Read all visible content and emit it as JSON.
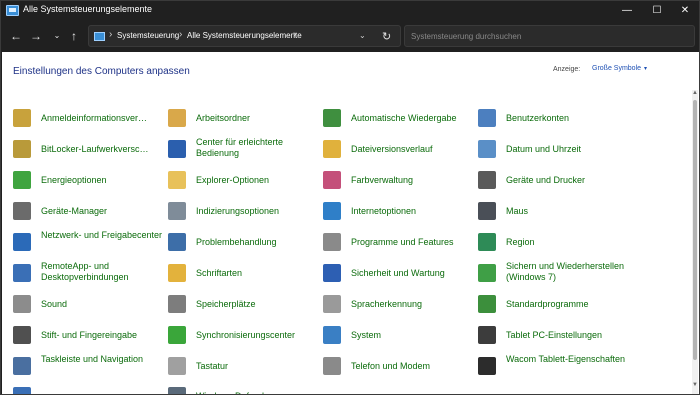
{
  "window": {
    "title": "Alle Systemsteuerungselemente",
    "minimize_glyph": "—",
    "maximize_glyph": "☐",
    "close_glyph": "✕"
  },
  "nav": {
    "back_glyph": "←",
    "forward_glyph": "→",
    "dropdown_glyph": "⌄",
    "up_glyph": "↑",
    "separator_glyph": "›",
    "refresh_glyph": "↻",
    "breadcrumbs": [
      "Systemsteuerung",
      "Alle Systemsteuerungselemente"
    ],
    "search_placeholder": "Systemsteuerung durchsuchen"
  },
  "header": {
    "title": "Einstellungen des Computers anpassen",
    "view_label": "Anzeige:",
    "view_value": "Große Symbole",
    "view_caret": "▾"
  },
  "items": [
    {
      "label": "Anmeldeinformationsver…",
      "icon": "credential-vault-icon",
      "color": "#c8a23c"
    },
    {
      "label": "Arbeitsordner",
      "icon": "work-folders-icon",
      "color": "#d9a84a"
    },
    {
      "label": "Automatische Wiedergabe",
      "icon": "autoplay-icon",
      "color": "#3f8f3f"
    },
    {
      "label": "Benutzerkonten",
      "icon": "user-accounts-icon",
      "color": "#4c7fbf"
    },
    {
      "label": "BitLocker-Laufwerkversc…",
      "icon": "bitlocker-key-icon",
      "color": "#b99a3a"
    },
    {
      "label": "Center für erleichterte Bedienung",
      "icon": "ease-of-access-icon",
      "color": "#2b5fae"
    },
    {
      "label": "Dateiversionsverlauf",
      "icon": "file-history-icon",
      "color": "#e0b13c"
    },
    {
      "label": "Datum und Uhrzeit",
      "icon": "date-time-icon",
      "color": "#5a8fc7"
    },
    {
      "label": "Energieoptionen",
      "icon": "power-options-icon",
      "color": "#3fa43f"
    },
    {
      "label": "Explorer-Optionen",
      "icon": "folder-options-icon",
      "color": "#e8c15a"
    },
    {
      "label": "Farbverwaltung",
      "icon": "color-management-icon",
      "color": "#c4507a"
    },
    {
      "label": "Geräte und Drucker",
      "icon": "printer-icon",
      "color": "#5a5a5a"
    },
    {
      "label": "Geräte-Manager",
      "icon": "device-manager-icon",
      "color": "#6b6b6b"
    },
    {
      "label": "Indizierungsoptionen",
      "icon": "indexing-icon",
      "color": "#7f8c99"
    },
    {
      "label": "Internetoptionen",
      "icon": "internet-options-icon",
      "color": "#2f7fc8"
    },
    {
      "label": "Maus",
      "icon": "mouse-icon",
      "color": "#4a4f57"
    },
    {
      "label": "Netzwerk- und Freigabecenter",
      "icon": "network-icon",
      "color": "#2b6ab8"
    },
    {
      "label": "Problembehandlung",
      "icon": "troubleshooting-icon",
      "color": "#3d6ea8"
    },
    {
      "label": "Programme und Features",
      "icon": "programs-features-icon",
      "color": "#8a8a8a"
    },
    {
      "label": "Region",
      "icon": "region-globe-icon",
      "color": "#2e8b57"
    },
    {
      "label": "RemoteApp- und Desktopverbindungen",
      "icon": "remoteapp-icon",
      "color": "#3a6fb6"
    },
    {
      "label": "Schriftarten",
      "icon": "fonts-icon",
      "color": "#e3b23c"
    },
    {
      "label": "Sicherheit und Wartung",
      "icon": "security-flag-icon",
      "color": "#2d5fb3"
    },
    {
      "label": "Sichern und Wiederherstellen (Windows 7)",
      "icon": "backup-restore-icon",
      "color": "#3f9f46"
    },
    {
      "label": "Sound",
      "icon": "speaker-icon",
      "color": "#8c8c8c"
    },
    {
      "label": "Speicherplätze",
      "icon": "storage-spaces-icon",
      "color": "#7d7d7d"
    },
    {
      "label": "Spracherkennung",
      "icon": "microphone-icon",
      "color": "#9a9a9a"
    },
    {
      "label": "Standardprogramme",
      "icon": "default-programs-icon",
      "color": "#3c8f3c"
    },
    {
      "label": "Stift- und Fingereingabe",
      "icon": "pen-icon",
      "color": "#505050"
    },
    {
      "label": "Synchronisierungscenter",
      "icon": "sync-center-icon",
      "color": "#3aa63a"
    },
    {
      "label": "System",
      "icon": "system-icon",
      "color": "#3a7fc4"
    },
    {
      "label": "Tablet PC-Einstellungen",
      "icon": "tablet-icon",
      "color": "#3c3c3c"
    },
    {
      "label": "Taskleiste und Navigation",
      "icon": "taskbar-icon",
      "color": "#4a6fa0"
    },
    {
      "label": "Tastatur",
      "icon": "keyboard-icon",
      "color": "#a0a0a0"
    },
    {
      "label": "Telefon und Modem",
      "icon": "phone-modem-icon",
      "color": "#8a8a8a"
    },
    {
      "label": "Wacom Tablett-Eigenschaften",
      "icon": "wacom-tablet-icon",
      "color": "#2c2c2c"
    },
    {
      "label": "",
      "icon": "unknown-icon",
      "color": "#3a6fb6"
    },
    {
      "label": "Windows Defender",
      "icon": "defender-shield-icon",
      "color": "#5a6a7a"
    }
  ],
  "scrollbar": {
    "up_glyph": "▲",
    "down_glyph": "▼"
  }
}
